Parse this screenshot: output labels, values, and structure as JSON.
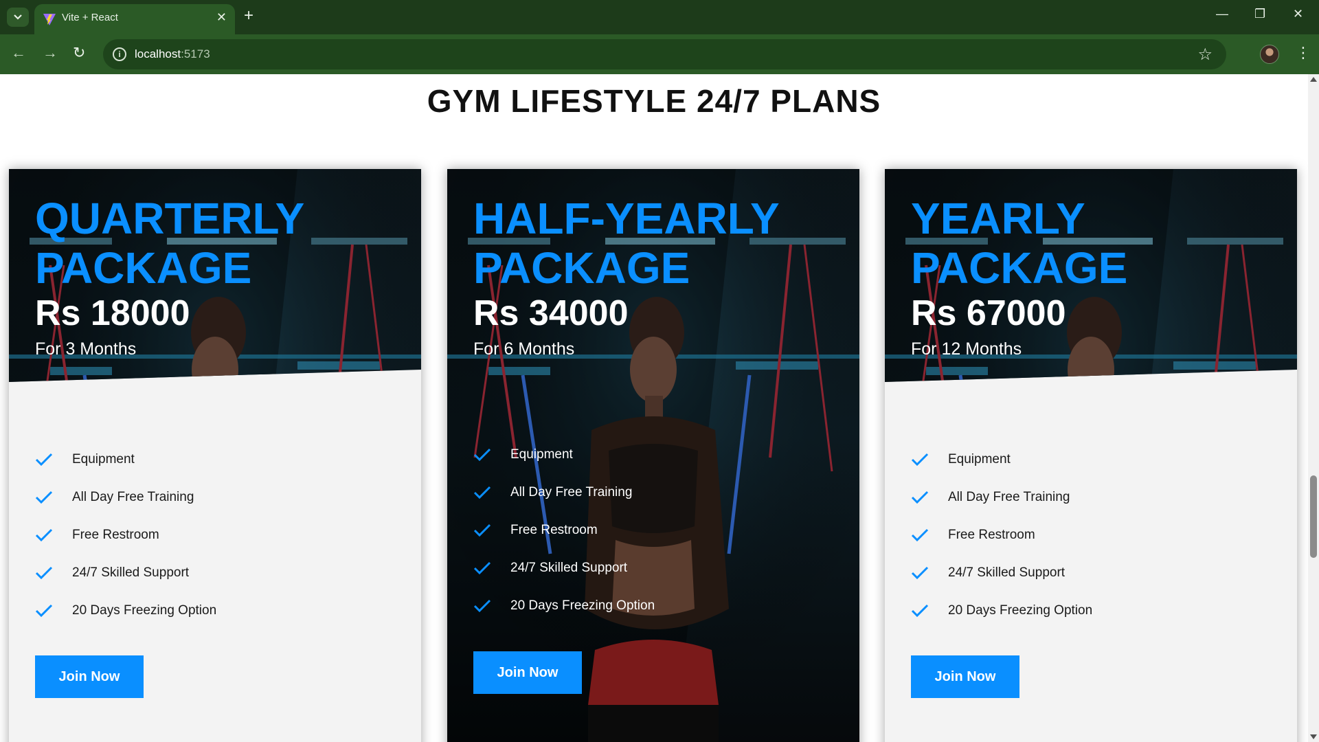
{
  "browser": {
    "tab_title": "Vite + React",
    "url_host": "localhost",
    "url_port": ":5173",
    "favicon": "vite-logo-icon"
  },
  "page": {
    "title": "GYM LIFESTYLE 24/7 PLANS"
  },
  "colors": {
    "accent": "#0a8fff",
    "browser_frame": "#2b5a26",
    "card_background": "#f3f3f3"
  },
  "plans": [
    {
      "name_line1": "QUARTERLY",
      "name_line2": "PACKAGE",
      "price": "Rs 18000",
      "duration": "For 3 Months",
      "features": [
        "Equipment",
        "All Day Free Training",
        "Free Restroom",
        "24/7 Skilled Support",
        "20 Days Freezing Option"
      ],
      "button_label": "Join Now",
      "highlighted": false
    },
    {
      "name_line1": "HALF-YEARLY",
      "name_line2": "PACKAGE",
      "price": "Rs 34000",
      "duration": "For 6 Months",
      "features": [
        "Equipment",
        "All Day Free Training",
        "Free Restroom",
        "24/7 Skilled Support",
        "20 Days Freezing Option"
      ],
      "button_label": "Join Now",
      "highlighted": true
    },
    {
      "name_line1": "YEARLY",
      "name_line2": "PACKAGE",
      "price": "Rs 67000",
      "duration": "For 12 Months",
      "features": [
        "Equipment",
        "All Day Free Training",
        "Free Restroom",
        "24/7 Skilled Support",
        "20 Days Freezing Option"
      ],
      "button_label": "Join Now",
      "highlighted": false
    }
  ]
}
